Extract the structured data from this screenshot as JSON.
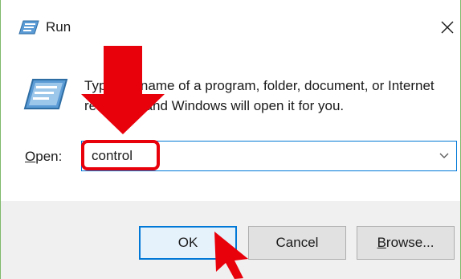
{
  "window": {
    "title": "Run",
    "icon": "run-icon"
  },
  "titlebar": {
    "close_icon": "close-icon"
  },
  "body": {
    "description": "Type the name of a program, folder, document, or Internet resource, and Windows will open it for you.",
    "icon": "run-program-icon"
  },
  "open_field": {
    "label_underlined": "O",
    "label_rest": "pen:",
    "value": "control",
    "dropdown_icon": "chevron-down-icon"
  },
  "buttons": {
    "ok": "OK",
    "cancel": "Cancel",
    "browse_underlined": "B",
    "browse_rest": "rowse..."
  },
  "annotations": {
    "highlight_color": "#e8000b",
    "arrow_down_icon": "red-down-arrow-icon",
    "cursor_arrow_icon": "red-cursor-arrow-icon"
  },
  "colors": {
    "accent": "#0078d7",
    "window_border": "#7fba6b",
    "footer_bg": "#f0f0f0"
  }
}
